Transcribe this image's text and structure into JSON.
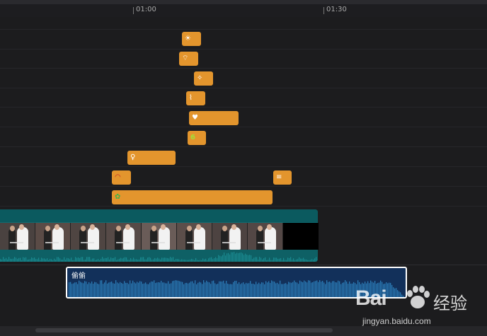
{
  "ruler": {
    "marks": [
      "01:00",
      "01:30"
    ]
  },
  "sticker_track": {
    "clips": [
      {
        "name": "sticker-sun",
        "glyph": "☀"
      },
      {
        "name": "sticker-fan",
        "glyph": "⌔"
      },
      {
        "name": "sticker-sparkle",
        "glyph": "✧"
      },
      {
        "name": "sticker-lips-small",
        "glyph": "⌇"
      },
      {
        "name": "sticker-hearts",
        "glyph": "♥"
      },
      {
        "name": "sticker-ring",
        "glyph": "6"
      },
      {
        "name": "sticker-bride",
        "glyph": "♀"
      },
      {
        "name": "sticker-lips",
        "glyph": "◠"
      },
      {
        "name": "sticker-text",
        "glyph": "≡"
      },
      {
        "name": "sticker-flowers",
        "glyph": "✿"
      }
    ]
  },
  "video_track": {
    "frame_count": 9
  },
  "audio_track": {
    "title": "偷偷"
  },
  "watermark": {
    "logo": "Bai",
    "cn": "经验",
    "url": "jingyan.baidu.com"
  },
  "colors": {
    "sticker": "#e3952d",
    "video": "#0f6a70",
    "audio": "#12305a",
    "audio_wave": "#2a7ab5"
  }
}
